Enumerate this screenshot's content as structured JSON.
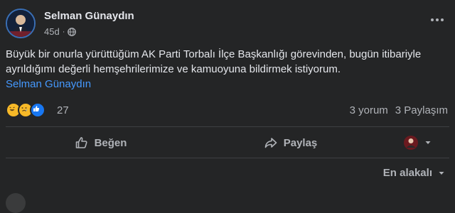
{
  "post": {
    "author": "Selman Günaydın",
    "time": "45d",
    "text": "Büyük bir onurla yürüttüğüm AK Parti Torbalı İlçe Başkanlığı görevinden, bugün itibariyle ayrıldığımı değerli hemşehrilerimize ve kamuoyuna bildirmek istiyorum.",
    "mention": "Selman Günaydın"
  },
  "reactions": {
    "icons": [
      "haha-icon",
      "sad-icon",
      "like-icon"
    ],
    "count": "27"
  },
  "counts": {
    "comments": "3 yorum",
    "shares": "3 Paylaşım"
  },
  "actions": {
    "like_label": "Beğen",
    "share_label": "Paylaş"
  },
  "comments": {
    "sort_label": "En alakalı"
  },
  "colors": {
    "background": "#242526",
    "text": "#e4e6eb",
    "secondary": "#b0b3b8",
    "link": "#4599ff"
  }
}
